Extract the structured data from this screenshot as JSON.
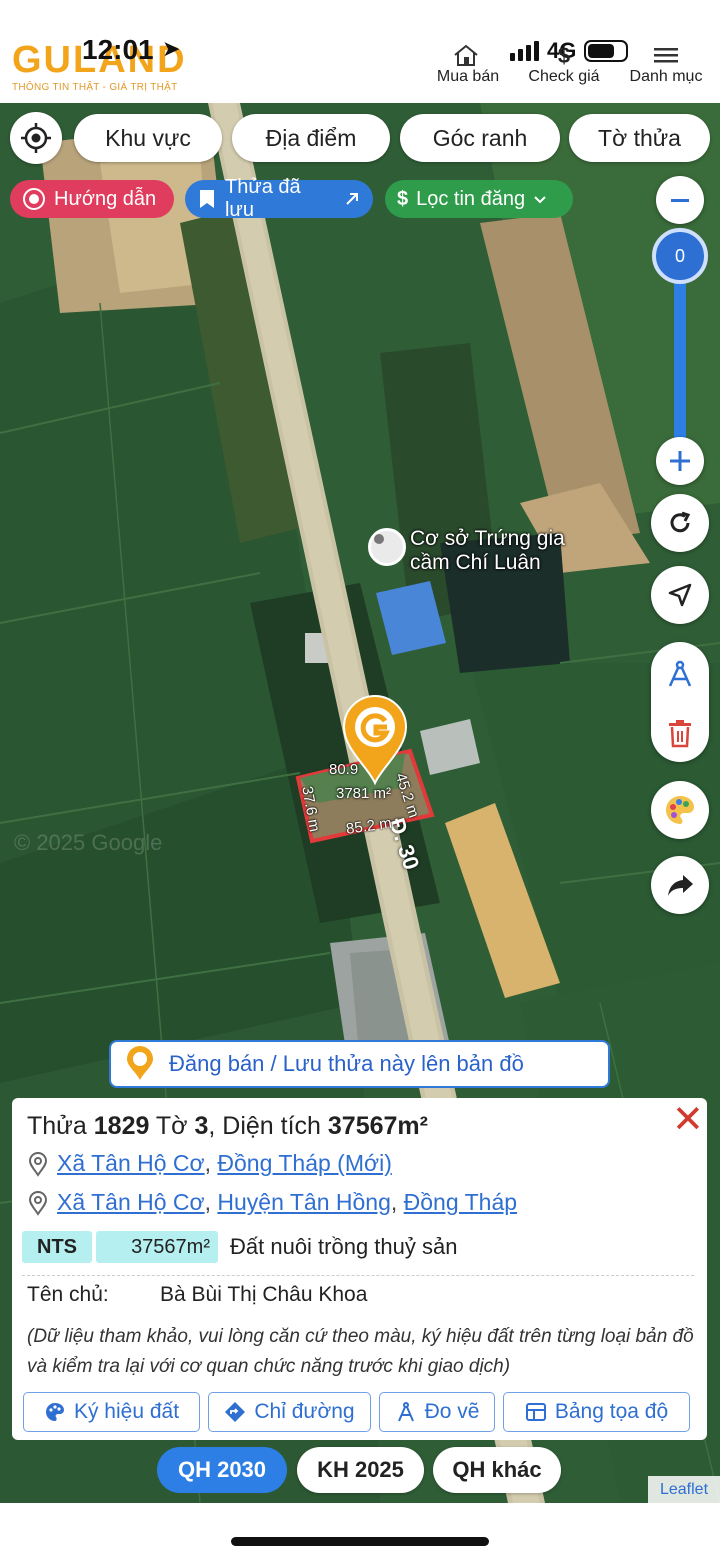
{
  "status_bar": {
    "time": "12:01",
    "network": "4G"
  },
  "header": {
    "logo": "GULAND",
    "tagline": "THÔNG TIN THẬT - GIÁ TRỊ THẬT",
    "nav": [
      {
        "label": "Mua bán",
        "icon": "house-icon"
      },
      {
        "label": "Check giá",
        "icon": "dollar-icon"
      },
      {
        "label": "Danh mục",
        "icon": "menu-icon"
      }
    ]
  },
  "map_controls": {
    "search_pills": [
      "Khu vực",
      "Địa điểm",
      "Góc ranh",
      "Tờ thửa"
    ],
    "chips": {
      "guide": "Hướng dẫn",
      "saved": "Thửa đã lưu",
      "filter": "Lọc tin đăng"
    },
    "zoom_level": "0"
  },
  "map": {
    "poi_name_line1": "Cơ sở Trứng gia",
    "poi_name_line2": "cầm Chí Luân",
    "road_label": "Đ. 30",
    "parcel": {
      "top": "80.9",
      "right": "45.2 m",
      "left": "37.6 m",
      "bottom": "85.2 m",
      "area": "3781 m²"
    },
    "watermark": "© 2025 Google"
  },
  "post_button": "Đăng bán / Lưu thửa này lên bản đồ",
  "panel": {
    "title_prefix": "Thửa ",
    "parcel_no": "1829",
    "sheet_prefix": " Tờ ",
    "sheet_no": "3",
    "area_prefix": ", Diện tích ",
    "area": "37567m²",
    "addr1": {
      "commune": "Xã Tân Hộ Cơ",
      "sep": ",",
      "province": "Đồng Tháp (Mới)"
    },
    "addr2": {
      "commune": "Xã Tân Hộ Cơ",
      "sep1": ",",
      "district": "Huyện Tân Hồng",
      "sep2": ",",
      "province": "Đồng Tháp"
    },
    "land_code": "NTS",
    "land_area": "37567m²",
    "land_use": "Đất nuôi trồng thuỷ sản",
    "owner_label": "Tên chủ:",
    "owner_name": "Bà Bùi Thị Châu Khoa",
    "note": "(Dữ liệu tham khảo, vui lòng căn cứ theo màu, ký hiệu đất trên từng loại bản đồ và kiểm tra lại với cơ quan chức năng trước khi giao dịch)",
    "actions": [
      "Ký hiệu đất",
      "Chỉ đường",
      "Đo vẽ",
      "Bảng tọa độ"
    ]
  },
  "tabs": [
    "QH 2030",
    "KH 2025",
    "QH khác"
  ],
  "attribution": "Leaflet"
}
